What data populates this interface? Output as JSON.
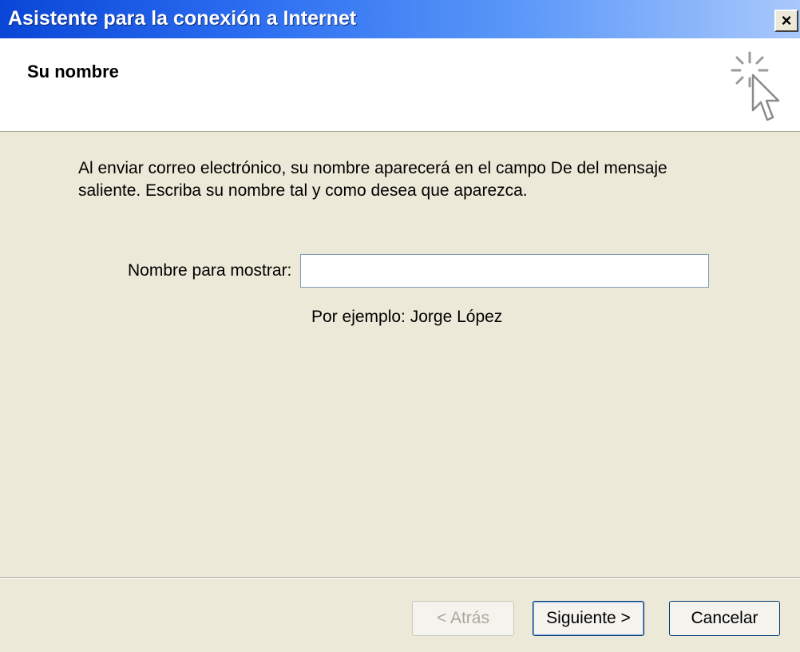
{
  "window": {
    "title": "Asistente para la conexión a Internet",
    "close_label": "×"
  },
  "header": {
    "title": "Su nombre",
    "icon": "wizard-cursor-sparkle-icon"
  },
  "content": {
    "description": "Al enviar correo electrónico, su nombre aparecerá en el campo De del mensaje saliente. Escriba su nombre tal y como desea que aparezca.",
    "display_name_label": "Nombre para mostrar:",
    "display_name_value": "",
    "example_text": "Por ejemplo: Jorge López"
  },
  "buttons": {
    "back": "< Atrás",
    "next": "Siguiente >",
    "cancel": "Cancelar"
  },
  "colors": {
    "titlebar_start": "#0a46d6",
    "titlebar_end": "#a9c8fc",
    "dialog_bg": "#ece9d8"
  }
}
